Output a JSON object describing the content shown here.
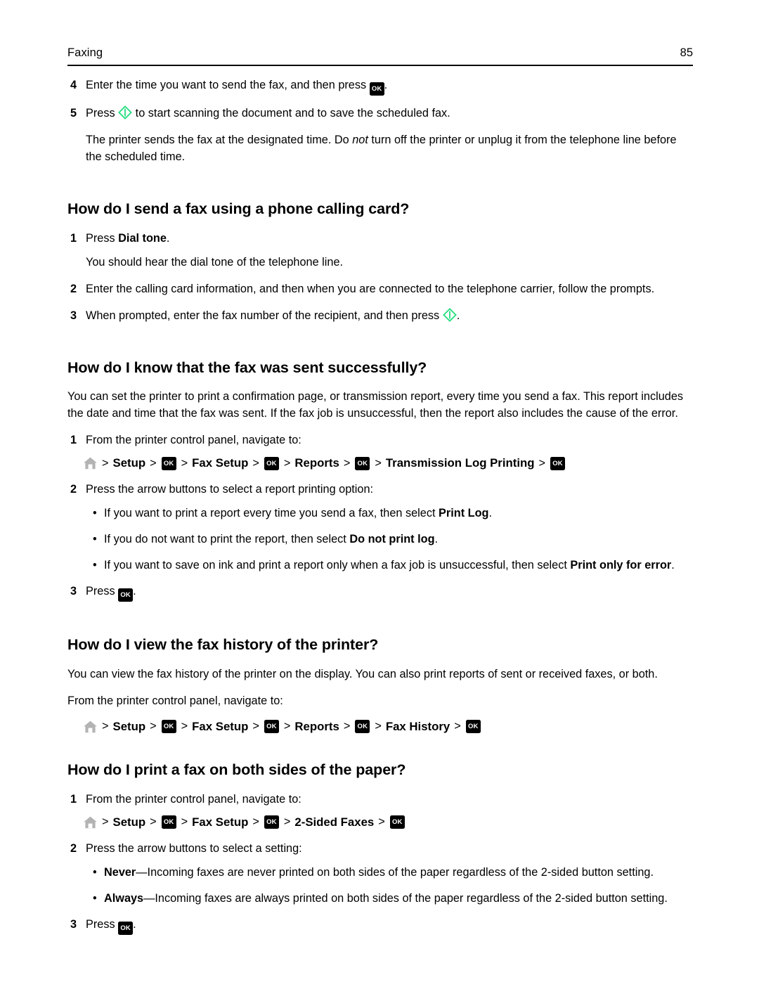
{
  "header": {
    "title": "Faxing",
    "page_number": "85"
  },
  "icons": {
    "ok_key_label": "OK",
    "start_key_name": "start-button-icon",
    "home_key_name": "home-icon",
    "start_color": "#22DD7E",
    "home_color": "#B3B3B3",
    "ok_bg": "#000000",
    "ok_fg": "#FFFFFF"
  },
  "intro_steps": [
    {
      "num": "4",
      "pre": "Enter the time you want to send the fax, and then press ",
      "glyph": "ok",
      "post": "."
    },
    {
      "num": "5",
      "pre": "Press ",
      "glyph": "start",
      "post": " to start scanning the document and to save the scheduled fax."
    }
  ],
  "intro_note": {
    "part1": "The printer sends the fax at the designated time. Do ",
    "italic": "not",
    "part2": " turn off the printer or unplug it from the telephone line before the scheduled time."
  },
  "sections": [
    {
      "heading": "How do I send a fax using a phone calling card?",
      "steps": [
        {
          "num": "1",
          "pre": "Press ",
          "bold": "Dial tone",
          "post": "."
        },
        {
          "num": "",
          "cont": "You should hear the dial tone of the telephone line."
        },
        {
          "num": "2",
          "pre": "Enter the calling card information, and then when you are connected to the telephone carrier, follow the prompts.",
          "post": ""
        },
        {
          "num": "3",
          "pre": "When prompted, enter the fax number of the recipient, and then press ",
          "glyph": "start",
          "post": "."
        }
      ]
    },
    {
      "heading": "How do I know that the fax was sent successfully?",
      "paragraph": "You can set the printer to print a confirmation page, or transmission report, every time you send a fax. This report includes the date and time that the fax was sent. If the fax job is unsuccessful, then the report also includes the cause of the error.",
      "step1_num": "1",
      "step1_text": "From the printer control panel, navigate to:",
      "breadcrumb": [
        "Setup",
        "Fax Setup",
        "Reports",
        "Transmission Log Printing"
      ],
      "step2_num": "2",
      "step2_text": "Press the arrow buttons to select a report printing option:",
      "bullets": [
        {
          "pre": "If you want to print a report every time you send a fax, then select ",
          "bold": "Print Log",
          "post": "."
        },
        {
          "pre": "If you do not want to print the report, then select ",
          "bold": "Do not print log",
          "post": "."
        },
        {
          "pre": "If you want to save on ink and print a report only when a fax job is unsuccessful, then select ",
          "bold": "Print only for error",
          "post": "."
        }
      ],
      "step3_num": "3",
      "step3_pre": "Press ",
      "step3_post": "."
    },
    {
      "heading": "How do I view the fax history of the printer?",
      "paragraph": "You can view the fax history of the printer on the display. You can also print reports of sent or received faxes, or both.",
      "lead": "From the printer control panel, navigate to:",
      "breadcrumb": [
        "Setup",
        "Fax Setup",
        "Reports",
        "Fax History"
      ]
    },
    {
      "heading": "How do I print a fax on both sides of the paper?",
      "step1_num": "1",
      "step1_text": "From the printer control panel, navigate to:",
      "breadcrumb": [
        "Setup",
        "Fax Setup",
        "2-Sided Faxes"
      ],
      "step2_num": "2",
      "step2_text": "Press the arrow buttons to select a setting:",
      "bullets": [
        {
          "bold": "Never",
          "post": "—Incoming faxes are never printed on both sides of the paper regardless of the 2-sided button setting."
        },
        {
          "bold": "Always",
          "post": "—Incoming faxes are always printed on both sides of the paper regardless of the 2-sided button setting."
        }
      ],
      "step3_num": "3",
      "step3_pre": "Press ",
      "step3_post": "."
    }
  ],
  "separator": ">"
}
